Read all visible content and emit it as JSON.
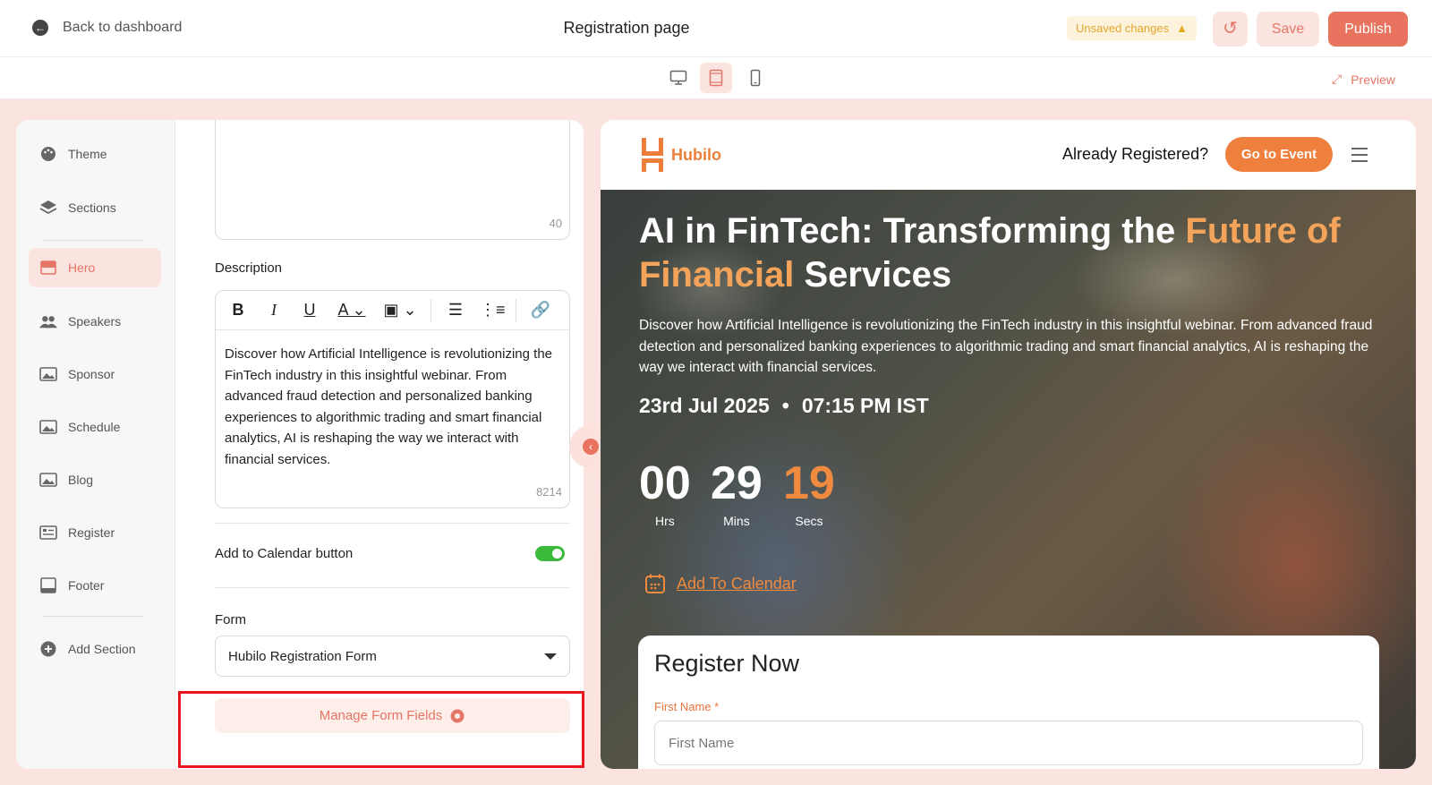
{
  "topbar": {
    "back_label": "Back to dashboard",
    "page_title": "Registration page",
    "unsaved_label": "Unsaved changes",
    "save_label": "Save",
    "publish_label": "Publish"
  },
  "devbar": {
    "devices": [
      "desktop-icon",
      "tablet-icon",
      "mobile-icon"
    ],
    "active_device": "tablet",
    "preview_label": "Preview"
  },
  "sidebar": {
    "items": [
      {
        "label": "Theme",
        "icon": "palette-icon"
      },
      {
        "label": "Sections",
        "icon": "layers-icon"
      },
      {
        "label": "Hero",
        "icon": "hero-icon",
        "active": true
      },
      {
        "label": "Speakers",
        "icon": "people-icon"
      },
      {
        "label": "Sponsor",
        "icon": "image-icon"
      },
      {
        "label": "Schedule",
        "icon": "image-icon"
      },
      {
        "label": "Blog",
        "icon": "image-icon"
      },
      {
        "label": "Register",
        "icon": "form-icon"
      },
      {
        "label": "Footer",
        "icon": "footer-icon"
      },
      {
        "label": "Add Section",
        "icon": "plus-circle-icon"
      }
    ]
  },
  "panel": {
    "title_counter": "40",
    "description_label": "Description",
    "description_text": "Discover how Artificial Intelligence is revolutionizing the FinTech industry in this insightful webinar. From advanced fraud detection and personalized banking experiences to algorithmic trading and smart financial analytics, AI is reshaping the way we interact with financial services.",
    "description_counter": "8214",
    "calendar_label": "Add to Calendar button",
    "calendar_enabled": true,
    "form_label": "Form",
    "form_value": "Hubilo Registration Form",
    "manage_label": "Manage Form Fields"
  },
  "preview": {
    "brand": "Hubilo",
    "already_registered": "Already Registered?",
    "go_to_event": "Go to Event",
    "title_part1": "AI in FinTech: Transforming the ",
    "title_accent": "Future of Financial",
    "title_part2": " Services",
    "description": "Discover how Artificial Intelligence is revolutionizing the FinTech industry in this insightful webinar. From advanced fraud detection and personalized banking experiences to algorithmic trading and smart financial analytics, AI is reshaping the way we interact with financial services.",
    "date": "23rd Jul 2025",
    "time": "07:15 PM IST",
    "countdown": {
      "hours": "00",
      "hours_label": "Hrs",
      "mins": "29",
      "mins_label": "Mins",
      "secs": "19",
      "secs_label": "Secs"
    },
    "add_to_calendar": "Add To Calendar",
    "register_title": "Register Now",
    "first_name_label": "First Name *",
    "first_name_placeholder": "First Name"
  },
  "colors": {
    "accent": "#e8735f",
    "orange": "#ef7f3c",
    "highlight": "#e8151d"
  }
}
